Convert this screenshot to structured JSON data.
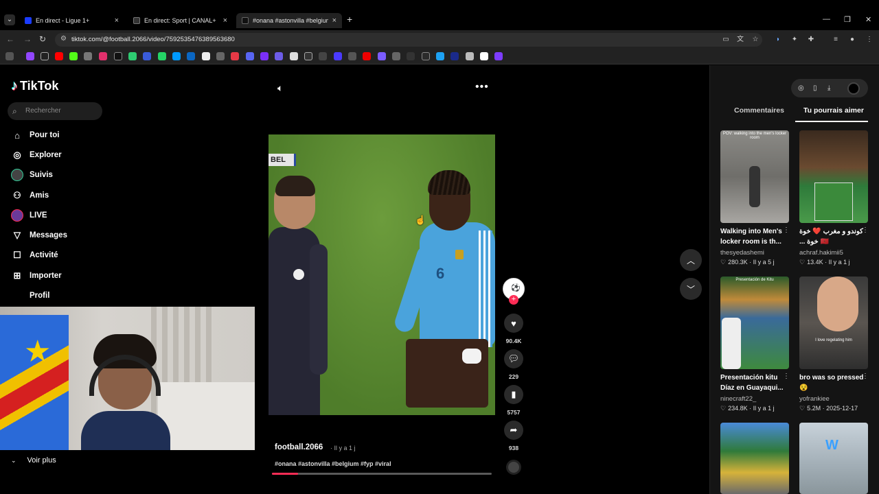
{
  "browser": {
    "tabs": [
      {
        "title": "En direct - Ligue 1+",
        "color": "#1a3cff"
      },
      {
        "title": "En direct: Sport | CANAL+",
        "color": "#000000"
      },
      {
        "title": "#onana #astonvilla #belgium #",
        "color": "#000000"
      }
    ],
    "new_tab": "+",
    "url": "tiktok.com/@football.2066/video/7592535476389563680"
  },
  "sidebar": {
    "logo": "TikTok",
    "search_placeholder": "Rechercher",
    "items": [
      {
        "label": "Pour toi",
        "icon": "home-icon"
      },
      {
        "label": "Explorer",
        "icon": "compass-icon"
      },
      {
        "label": "Suivis",
        "icon": "avatar-icon"
      },
      {
        "label": "Amis",
        "icon": "friends-icon"
      },
      {
        "label": "LIVE",
        "icon": "live-icon"
      },
      {
        "label": "Messages",
        "icon": "send-icon"
      },
      {
        "label": "Activité",
        "icon": "inbox-icon"
      },
      {
        "label": "Importer",
        "icon": "upload-icon"
      },
      {
        "label": "Profil",
        "icon": "profile-icon"
      }
    ],
    "see_more": "Voir plus"
  },
  "video": {
    "badge": "BEL",
    "jersey_number": "6",
    "author": "football.2066",
    "age": "· Il y a 1 j",
    "caption": "#onana #astonvilla #belgium #fyp #viral",
    "progress": 0.12
  },
  "actions": {
    "likes": "90.4K",
    "comments": "229",
    "saves": "5757",
    "shares": "938"
  },
  "right_panel": {
    "tabs": [
      "Commentaires",
      "Tu pourrais aimer"
    ],
    "active_tab": "Tu pourrais aimer",
    "cards": [
      {
        "title": "Walking into Men's locker room is th...",
        "user": "thesyedashemi",
        "likes": "280.3K",
        "age": "Il y a 5 j",
        "overlay": "POV: walking into the men's locker room"
      },
      {
        "title": "كوندو و مغرب ❤️ خوة 🇲🇦 خوة ...",
        "user": "achraf.hakimii5",
        "likes": "13.4K",
        "age": "Il y a 1 j",
        "overlay": ""
      },
      {
        "title": "Presentación kitu Díaz en Guayaqui...",
        "user": "ninecraft22_",
        "likes": "234.8K",
        "age": "Il y a 1 j",
        "overlay": "Presentación de Kitu"
      },
      {
        "title": "bro was so pressed 😵",
        "user": "yofrankiee",
        "likes": "5.2M",
        "age": "2025-12-17",
        "overlay": "I love regelating him"
      },
      {
        "title": "",
        "user": "",
        "likes": "",
        "age": "",
        "overlay": ""
      },
      {
        "title": "",
        "user": "",
        "likes": "",
        "age": "",
        "overlay": ""
      }
    ]
  },
  "colors": {
    "accent": "#fe2c55",
    "background": "#000000",
    "panel": "#141414"
  }
}
